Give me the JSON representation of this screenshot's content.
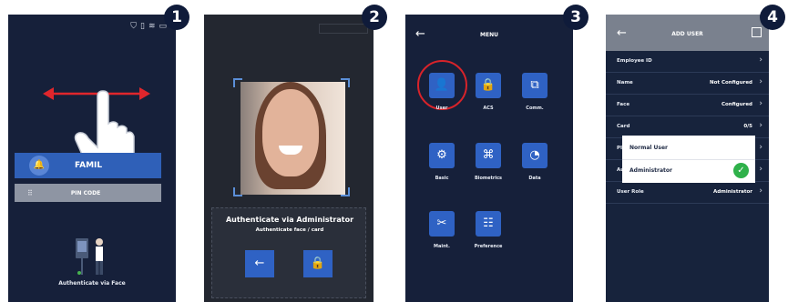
{
  "steps": [
    "1",
    "2",
    "3",
    "4"
  ],
  "screen1": {
    "status_icons": [
      "shield-icon",
      "sim-icon",
      "wifi-icon",
      "battery-icon"
    ],
    "face_button_label": "FAMIL",
    "pin_button_label": "PIN CODE",
    "footer_text": "Authenticate via Face"
  },
  "screen2": {
    "title": "Authenticate via Administrator",
    "subtitle": "Authenticate face / card",
    "buttons": [
      "back-arrow-icon",
      "lock-icon"
    ]
  },
  "screen3": {
    "title": "MENU",
    "items": [
      {
        "label": "User",
        "icon": "user-icon"
      },
      {
        "label": "ACS",
        "icon": "lock-icon"
      },
      {
        "label": "Comm.",
        "icon": "network-icon"
      },
      {
        "label": "Basic",
        "icon": "gear-icon"
      },
      {
        "label": "Biometrics",
        "icon": "fingerprint-icon"
      },
      {
        "label": "Data",
        "icon": "chart-icon"
      },
      {
        "label": "Maint.",
        "icon": "tools-icon"
      },
      {
        "label": "Preference",
        "icon": "sliders-icon"
      }
    ]
  },
  "screen4": {
    "title": "ADD USER",
    "rows": [
      {
        "label": "Employee ID",
        "value": ""
      },
      {
        "label": "Name",
        "value": "Not Configured"
      },
      {
        "label": "Face",
        "value": "Configured"
      },
      {
        "label": "Card",
        "value": "0/5"
      },
      {
        "label": "PIN",
        "value": ""
      },
      {
        "label": "Au",
        "value": ""
      },
      {
        "label": "User Role",
        "value": "Administrator"
      }
    ],
    "popup": {
      "option1": "Normal User",
      "option2": "Administrator",
      "selected": "Administrator"
    }
  }
}
